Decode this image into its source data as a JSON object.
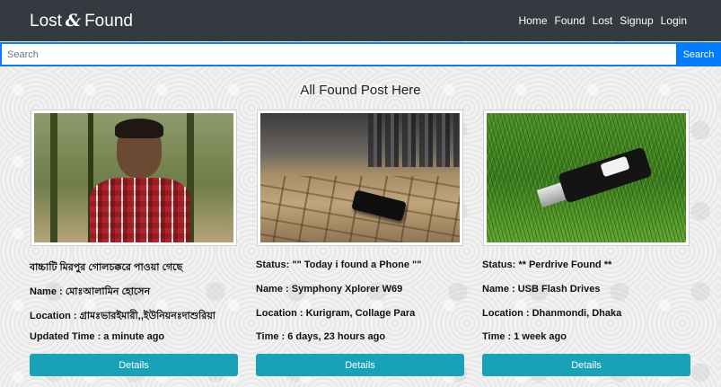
{
  "brand": {
    "part1": "Lost",
    "amp": "&",
    "part2": "Found"
  },
  "nav": {
    "items": [
      {
        "label": "Home"
      },
      {
        "label": "Found"
      },
      {
        "label": "Lost"
      },
      {
        "label": "Signup"
      },
      {
        "label": "Login"
      }
    ]
  },
  "search": {
    "placeholder": "Search",
    "button_label": "Search"
  },
  "heading": "All Found Post Here",
  "posts": [
    {
      "title": "বাচ্চাটি মিরপুর গোলচক্করে পাওয়া গেছে",
      "name": "Name : মোঃআলামিন হোসেন",
      "location": "Location : গ্রামঃভারইমারী,,ইউনিয়নঃদাশুরিয়া",
      "time": "Updated Time : a minute ago",
      "button": "Details"
    },
    {
      "title": "Status: \"\" Today i found a Phone \"\"",
      "name": "Name : Symphony Xplorer W69",
      "location": "Location : Kurigram, Collage Para",
      "time": "Time : 6 days, 23 hours ago",
      "button": "Details"
    },
    {
      "title": "Status: ** Perdrive Found **",
      "name": "Name : USB Flash Drives",
      "location": "Location : Dhanmondi, Dhaka",
      "time": "Time : 1 week ago",
      "button": "Details"
    }
  ]
}
